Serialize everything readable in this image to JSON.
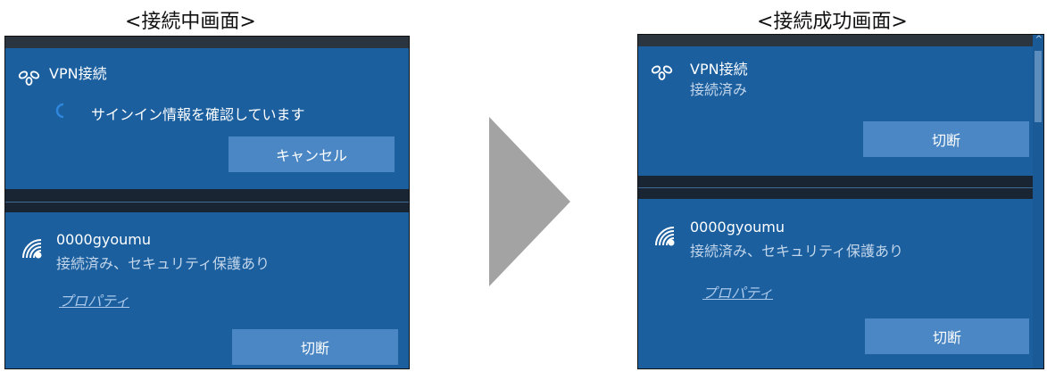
{
  "captions": {
    "left": "<接続中画面>",
    "right": "<接続成功画面>"
  },
  "left_panel": {
    "vpn": {
      "icon": "vpn-link-icon",
      "name": "VPN接続",
      "status": "サインイン情報を確認しています",
      "cancel_label": "キャンセル"
    },
    "wifi": {
      "icon": "wifi-secure-icon",
      "ssid": "0000gyoumu",
      "status": "接続済み、セキュリティ保護あり",
      "properties_link": "プロパティ",
      "disconnect_label": "切断"
    }
  },
  "right_panel": {
    "vpn": {
      "icon": "vpn-link-icon",
      "name": "VPN接続",
      "status": "接続済み",
      "disconnect_label": "切断"
    },
    "wifi": {
      "icon": "wifi-secure-icon",
      "ssid": "0000gyoumu",
      "status": "接続済み、セキュリティ保護あり",
      "properties_link": "プロパティ",
      "disconnect_label": "切断"
    }
  },
  "colors": {
    "panel_bg": "#1b5f9f",
    "button_bg": "#4a87c4",
    "arrow": "#a3a3a3",
    "divider": "#1a2533"
  }
}
